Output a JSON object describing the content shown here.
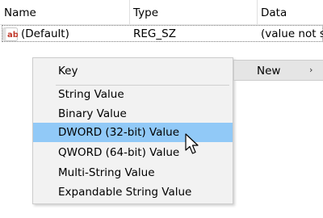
{
  "columns": {
    "name": "Name",
    "type": "Type",
    "data": "Data"
  },
  "rows": [
    {
      "icon": "string-value-icon",
      "name": "(Default)",
      "type": "REG_SZ",
      "data": "(value not s"
    }
  ],
  "context_menu": {
    "items": [
      {
        "label": "Key"
      },
      {
        "label": "String Value"
      },
      {
        "label": "Binary Value"
      },
      {
        "label": "DWORD (32-bit) Value",
        "highlighted": true
      },
      {
        "label": "QWORD (64-bit) Value"
      },
      {
        "label": "Multi-String Value"
      },
      {
        "label": "Expandable String Value"
      }
    ]
  },
  "parent_menu": {
    "new_label": "New",
    "arrow": "›"
  },
  "icons": {
    "cursor": "mouse-pointer-icon",
    "row_icon": "string-value-icon"
  },
  "colors": {
    "highlight": "#91c9f7",
    "menu_bg": "#f2f2f2",
    "icon_red": "#c0392b"
  }
}
